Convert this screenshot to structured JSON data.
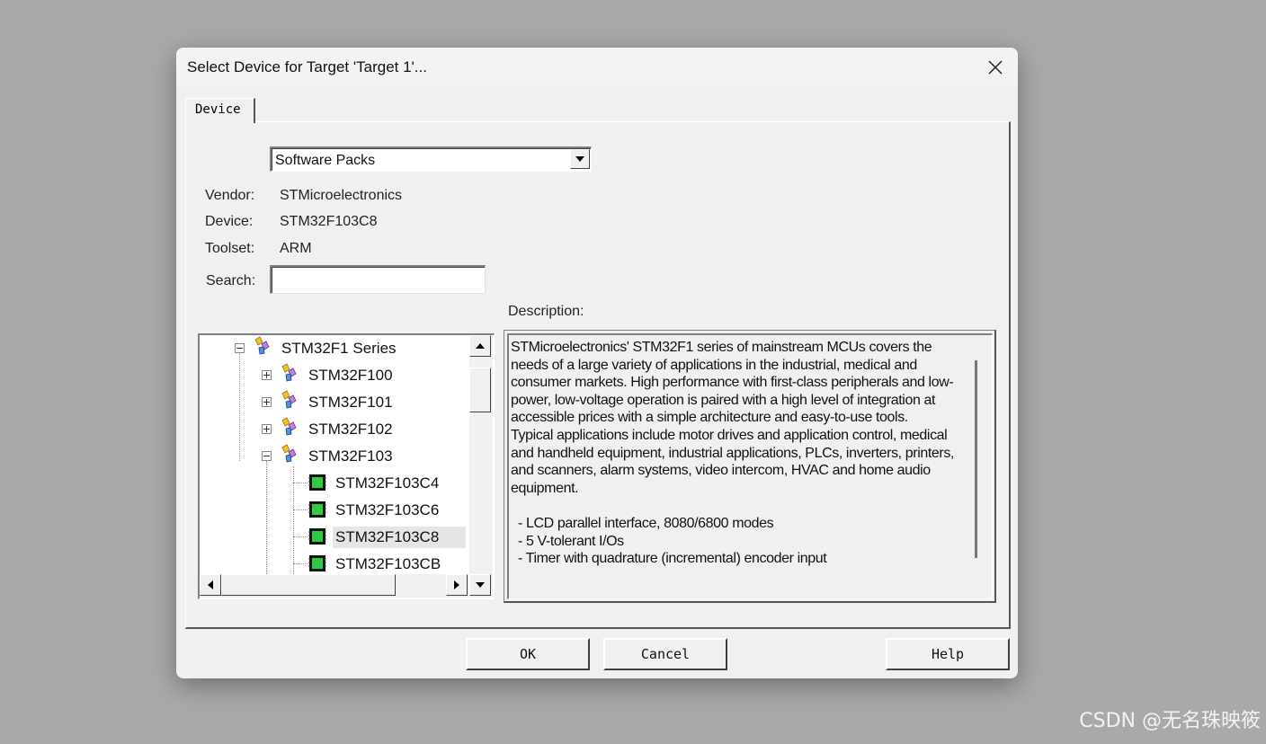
{
  "dialog": {
    "title": "Select Device for Target 'Target 1'...",
    "tab": "Device",
    "source_select": "Software Packs",
    "fields": {
      "vendor_label": "Vendor:",
      "vendor": "STMicroelectronics",
      "device_label": "Device:",
      "device": "STM32F103C8",
      "toolset_label": "Toolset:",
      "toolset": "ARM",
      "search_label": "Search:",
      "search_value": ""
    },
    "description_label": "Description:",
    "description": {
      "paragraph1": "STMicroelectronics' STM32F1 series of mainstream MCUs covers the needs of a large variety of applications in the industrial, medical and consumer markets. High performance with first-class peripherals and low-power, low-voltage operation is paired with a high level of integration at accessible prices with a simple architecture and easy-to-use tools.",
      "paragraph2": "Typical applications include motor drives and application control, medical and handheld equipment, industrial applications, PLCs, inverters, printers, and scanners, alarm systems, video intercom, HVAC and home audio equipment.",
      "bullets": [
        "- LCD parallel interface, 8080/6800 modes",
        "- 5 V-tolerant I/Os",
        "- Timer with quadrature (incremental) encoder input"
      ]
    },
    "tree": {
      "series": "STM32F1 Series",
      "groups": [
        "STM32F100",
        "STM32F101",
        "STM32F102",
        "STM32F103"
      ],
      "devices": [
        "STM32F103C4",
        "STM32F103C6",
        "STM32F103C8",
        "STM32F103CB"
      ],
      "selected": "STM32F103C8"
    },
    "buttons": {
      "ok": "OK",
      "cancel": "Cancel",
      "help": "Help"
    }
  },
  "watermark": "CSDN @无名珠映筱",
  "colors": {
    "background": "#a9a9a9",
    "dialog": "#f0f0f0",
    "chip_green": "#2ecc40"
  },
  "icons": [
    "close-icon",
    "dropdown-arrow-icon",
    "collapse-icon",
    "expand-icon",
    "device-family-icon",
    "chip-icon",
    "scroll-up-icon",
    "scroll-down-icon",
    "scroll-left-icon",
    "scroll-right-icon"
  ]
}
